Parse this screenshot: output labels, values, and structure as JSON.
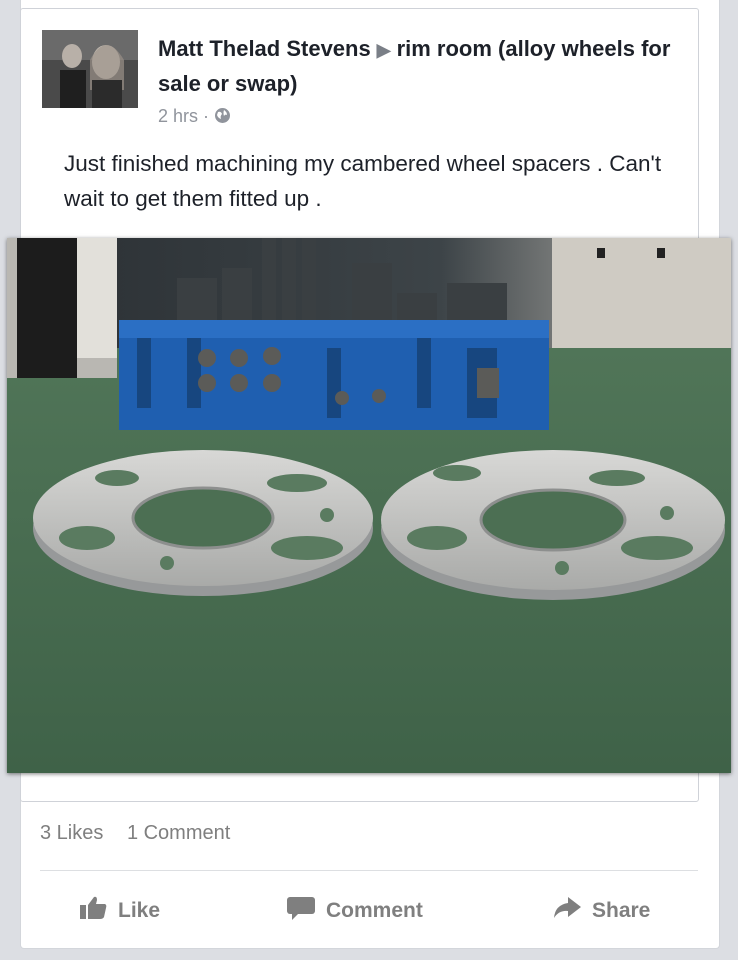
{
  "post": {
    "author": "Matt Thelad Stevens",
    "group": "rim room (alloy wheels for sale or swap)",
    "time": "2 hrs",
    "separator": "·",
    "text": "Just finished machining my cambered wheel spacers . Can't wait to get them fitted up ."
  },
  "stats": {
    "likes": "3 Likes",
    "comments": "1 Comment"
  },
  "actions": {
    "like": "Like",
    "comment": "Comment",
    "share": "Share"
  },
  "icons": {
    "arrow": "right-triangle-icon",
    "privacy": "globe-icon",
    "like": "thumbs-up-icon",
    "comment": "speech-bubble-icon",
    "share": "share-arrow-icon"
  },
  "colors": {
    "text": "#1d2129",
    "meta": "#90949c",
    "action": "#7f7f7f",
    "blue_tray": "#1f5fb0",
    "floor": "#4f7358"
  }
}
